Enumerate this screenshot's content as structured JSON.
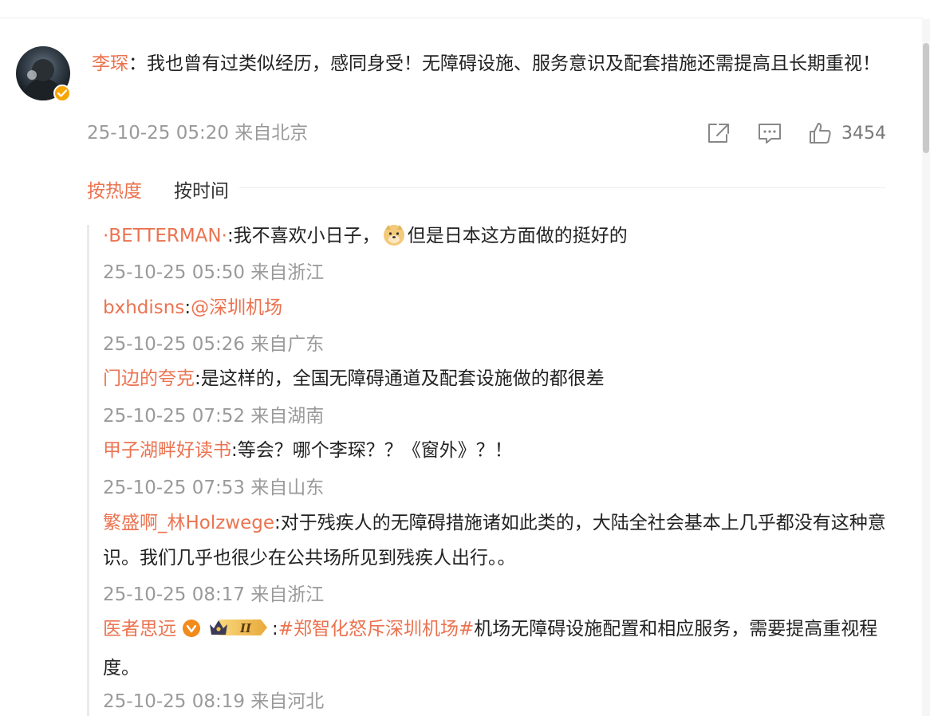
{
  "main_comment": {
    "username": "李琛",
    "text": "：我也曾有过类似经历，感同身受！无障碍设施、服务意识及配套措施还需提高且长期重视！",
    "timestamp": "25-10-25 05:20 来自北京",
    "like_count": "3454",
    "icons": [
      "share-icon",
      "comment-icon",
      "like-icon",
      "verify-badge-icon"
    ]
  },
  "tabs": [
    {
      "label": "按热度",
      "active": true
    },
    {
      "label": "按时间",
      "active": false
    }
  ],
  "replies": [
    {
      "username": "·BETTERMAN·",
      "text_before": ":我不喜欢小日子，",
      "emoji": "doge-emoji",
      "text_after": "但是日本这方面做的挺好的",
      "meta": "25-10-25 05:50 来自浙江"
    },
    {
      "username": "bxhdisns",
      "text_before": ":",
      "mention": "@深圳机场",
      "meta": "25-10-25 05:26 来自广东"
    },
    {
      "username": "门边的夸克",
      "text": ":是这样的，全国无障碍通道及配套设施做的都很差",
      "meta": "25-10-25 07:52 来自湖南"
    },
    {
      "username": "甲子湖畔好读书",
      "text": ":等会？哪个李琛？？《窗外》？！",
      "meta": "25-10-25 07:53 来自山东"
    },
    {
      "username": "繁盛啊_林Holzwege",
      "text": ":对于残疾人的无障碍措施诸如此类的，大陆全社会基本上几乎都没有这种意识。我们几乎也很少在公共场所见到残疾人出行。。",
      "meta": "25-10-25 08:17 来自浙江"
    },
    {
      "username": "医者思远",
      "badges": [
        "vip-icon",
        "crown-level-icon"
      ],
      "level_text": "II",
      "text_before": ":",
      "hashtag": "#郑智化怒斥深圳机场#",
      "text_after": "机场无障碍设施配置和相应服务，需要提高重视程度。",
      "meta": "25-10-25 08:19 来自河北"
    }
  ],
  "colors": {
    "username": "#eb7350",
    "meta": "#9a9a9a",
    "text": "#222222"
  }
}
